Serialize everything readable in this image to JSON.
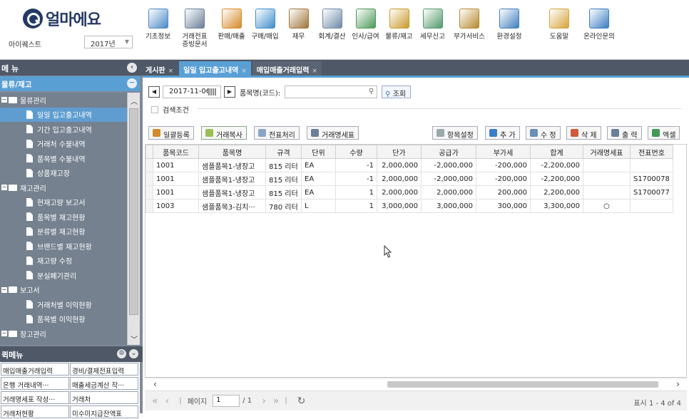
{
  "header": {
    "brand": "얼마에요",
    "user": "아이퀘스트",
    "year": "2017년",
    "menu": [
      {
        "label": "기초정보",
        "icon": "basic-info-icon",
        "color": "#4a88c6"
      },
      {
        "label": "거래전표\n증빙문서",
        "icon": "voucher-doc-icon",
        "color": "#6b7f98"
      },
      {
        "label": "판매/매출",
        "icon": "sales-icon",
        "color": "#d68a2a"
      },
      {
        "label": "구매/매입",
        "icon": "purchase-icon",
        "color": "#3f8dcc"
      },
      {
        "label": "재무",
        "icon": "finance-bag-icon",
        "color": "#a0763a"
      },
      {
        "label": "회계/결산",
        "icon": "accounting-icon",
        "color": "#6f8aa8"
      },
      {
        "label": "인사/급여",
        "icon": "hr-payroll-icon",
        "color": "#4b9a57"
      },
      {
        "label": "물류/재고",
        "icon": "logistics-truck-icon",
        "color": "#c89a2c"
      },
      {
        "label": "세무신고",
        "icon": "tax-report-icon",
        "color": "#4f9a6a"
      },
      {
        "label": "부가서비스",
        "icon": "extra-service-icon",
        "color": "#b78a2e"
      },
      {
        "label": "환경설정",
        "icon": "settings-gear-icon",
        "color": "#3f7fbe"
      },
      {
        "label": "도움말",
        "icon": "help-book-icon",
        "color": "#d6a43a"
      },
      {
        "label": "온라인문의",
        "icon": "online-inquiry-icon",
        "color": "#3a7ec2"
      }
    ]
  },
  "sidebar": {
    "title": "메 뉴",
    "category": "물류/재고",
    "tree": [
      {
        "type": "folder",
        "label": "물류관리"
      },
      {
        "type": "doc",
        "label": "일일 입고출고내역",
        "selected": true
      },
      {
        "type": "doc",
        "label": "기간 입고출고내역"
      },
      {
        "type": "doc",
        "label": "거래처 수불내역"
      },
      {
        "type": "doc",
        "label": "품목별 수불내역"
      },
      {
        "type": "doc",
        "label": "상품재고장"
      },
      {
        "type": "folder",
        "label": "재고관리"
      },
      {
        "type": "doc",
        "label": "현재고량 보고서"
      },
      {
        "type": "doc",
        "label": "품목별 재고현황"
      },
      {
        "type": "doc",
        "label": "분류별 재고현황"
      },
      {
        "type": "doc",
        "label": "브랜드별 재고현황"
      },
      {
        "type": "doc",
        "label": "재고량 수정"
      },
      {
        "type": "doc",
        "label": "분실폐기관리"
      },
      {
        "type": "folder",
        "label": "보고서"
      },
      {
        "type": "doc",
        "label": "거래처별 이익현황"
      },
      {
        "type": "doc",
        "label": "품목별 이익현황"
      },
      {
        "type": "folder",
        "label": "창고관리"
      }
    ],
    "fav_title": "퀵메뉴",
    "fav": [
      [
        "매입매출거래입력",
        "경비/결제전표입력"
      ],
      [
        "은행 거래내역···",
        "매출세금계산 작···"
      ],
      [
        "거래명세표 작성···",
        "거래처"
      ],
      [
        "거래처현황",
        "미수미지급잔액표"
      ]
    ]
  },
  "tabs": [
    {
      "label": "게시판",
      "active": false
    },
    {
      "label": "일일 입고출고내역",
      "active": true
    },
    {
      "label": "매입매출거래입력",
      "active": false
    }
  ],
  "search": {
    "date": "2017-11-06",
    "item_label": "품목명(코드):",
    "item_value": "",
    "query_label": "조회",
    "condition_label": "검색조건"
  },
  "toolbar": {
    "bulk_register": "일괄등록",
    "copy_trade": "거래복사",
    "process_voucher": "전표처리",
    "trade_statement": "거래명세표",
    "column_settings": "항목설정",
    "add": "추 가",
    "edit": "수 정",
    "delete": "삭 제",
    "print": "출 력",
    "excel": "엑셀"
  },
  "grid": {
    "columns": [
      "품목코드",
      "품목명",
      "규격",
      "단위",
      "수량",
      "단가",
      "공급가",
      "부가세",
      "합계",
      "거래명세표",
      "전표번호"
    ],
    "rows": [
      [
        "1001",
        "샘플품목1-냉장고",
        "815 리터",
        "EA",
        "-1",
        "2,000,000",
        "-2,000,000",
        "-200,000",
        "-2,200,000",
        "",
        ""
      ],
      [
        "1001",
        "샘플품목1-냉장고",
        "815 리터",
        "EA",
        "-1",
        "2,000,000",
        "-2,000,000",
        "-200,000",
        "-2,200,000",
        "",
        "S1700078"
      ],
      [
        "1001",
        "샘플품목1-냉장고",
        "815 리터",
        "EA",
        "1",
        "2,000,000",
        "2,000,000",
        "200,000",
        "2,200,000",
        "",
        "S1700077"
      ],
      [
        "1003",
        "샘플품목3-김치···",
        "780 리터",
        "L",
        "1",
        "3,000,000",
        "3,000,000",
        "300,000",
        "3,300,000",
        "○",
        ""
      ]
    ]
  },
  "pager": {
    "page_label": "페이지",
    "page": "1",
    "total": "/ 1",
    "info": "표시 1 - 4 of 4"
  }
}
